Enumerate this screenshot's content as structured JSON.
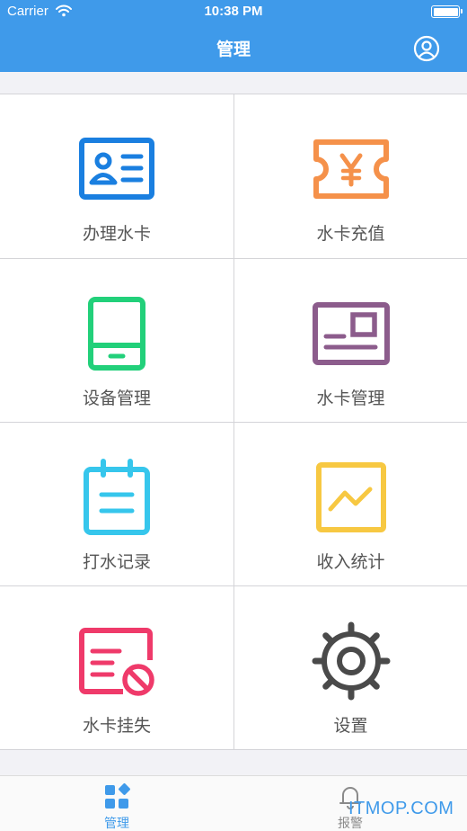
{
  "status_bar": {
    "carrier": "Carrier",
    "time": "10:38 PM"
  },
  "nav": {
    "title": "管理",
    "profile_icon": "user-circle-icon"
  },
  "menu": {
    "items": [
      {
        "label": "办理水卡",
        "icon": "id-card-icon",
        "color": "#1a7fe0"
      },
      {
        "label": "水卡充值",
        "icon": "yen-ticket-icon",
        "color": "#f5914a"
      },
      {
        "label": "设备管理",
        "icon": "tablet-icon",
        "color": "#22d07a"
      },
      {
        "label": "水卡管理",
        "icon": "card-manage-icon",
        "color": "#8c5c8c"
      },
      {
        "label": "打水记录",
        "icon": "calendar-record-icon",
        "color": "#36c6ec"
      },
      {
        "label": "收入统计",
        "icon": "trend-chart-icon",
        "color": "#f7c842"
      },
      {
        "label": "水卡挂失",
        "icon": "card-block-icon",
        "color": "#ef3a6a"
      },
      {
        "label": "设置",
        "icon": "gear-icon",
        "color": "#4a4a4a"
      }
    ]
  },
  "tabbar": {
    "tabs": [
      {
        "label": "管理",
        "icon": "grid-icon",
        "active": true
      },
      {
        "label": "报警",
        "icon": "bell-icon",
        "active": false
      }
    ]
  },
  "watermark": "ITMOP.COM",
  "colors": {
    "primary": "#3f9aea",
    "background": "#f2f2f6"
  }
}
